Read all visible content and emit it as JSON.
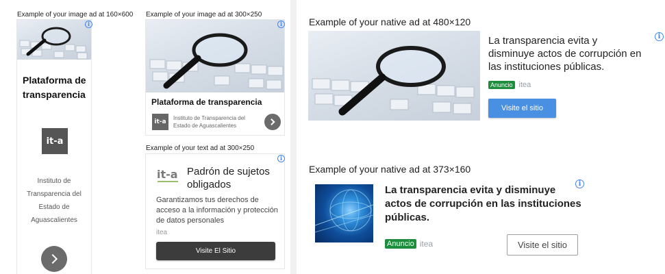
{
  "left_panel": {
    "ad160": {
      "caption": "Example of your image ad at 160×600",
      "title": "Plataforma de transparencia",
      "logo_text": "it-a",
      "advertiser_lines": [
        "Instituto de",
        "Transparencia del",
        "Estado de",
        "Aguascalientes"
      ]
    },
    "ad300": {
      "caption": "Example of your image ad at 300×250",
      "title": "Plataforma de transparencia",
      "logo_text": "it-a",
      "advertiser": "Instituto de Transparencia del Estado de Aguascalientes"
    },
    "text_ad": {
      "caption": "Example of your text ad at 300×250",
      "brand": "it-a",
      "headline": "Padrón de sujetos obligados",
      "body": "Garantizamos tus derechos de acceso a la información y protección de datos personales",
      "advertiser": "itea",
      "button": "Visite El Sitio"
    }
  },
  "right_panel": {
    "native480": {
      "caption": "Example of your native ad at 480×120",
      "headline": "La transparencia evita y disminuye actos de corrupción en las instituciones públicas.",
      "badge": "Anuncio",
      "advertiser": "itea",
      "button": "Visite el sitio"
    },
    "native373": {
      "caption": "Example of your native ad at 373×160",
      "headline": "La transparencia evita y disminuye actos de corrupción en las instituciones públicas.",
      "badge": "Anuncio",
      "advertiser": "itea",
      "button": "Visite el sitio"
    }
  },
  "icons": {
    "info": "info-icon",
    "arrow": "chevron-right-icon"
  },
  "colors": {
    "badge_green": "#1e8e3e",
    "button_blue": "#4a90e2",
    "info_blue": "#4285f4"
  }
}
